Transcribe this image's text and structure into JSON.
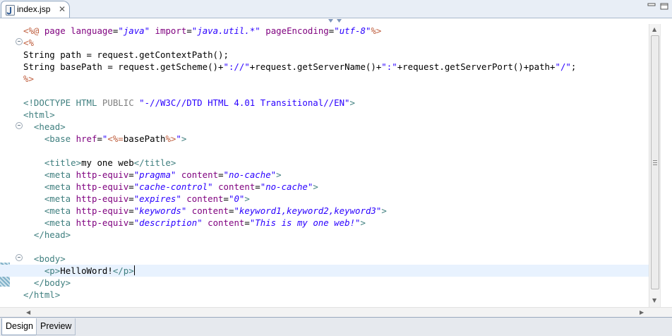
{
  "editor_tab": {
    "filename": "index.jsp",
    "icon": "jsp-file-icon",
    "close": "✕"
  },
  "code_lines": [
    [
      [
        "jsp",
        "<%@ "
      ],
      [
        "attr",
        "page "
      ],
      [
        "attr",
        "language"
      ],
      [
        "text",
        "="
      ],
      [
        "val",
        "\"java\""
      ],
      [
        "text",
        " "
      ],
      [
        "attr",
        "import"
      ],
      [
        "text",
        "="
      ],
      [
        "val",
        "\"java.util.*\""
      ],
      [
        "text",
        " "
      ],
      [
        "attr",
        "pageEncoding"
      ],
      [
        "text",
        "="
      ],
      [
        "val",
        "\"utf-8\""
      ],
      [
        "jsp",
        "%>"
      ]
    ],
    [
      [
        "jsp",
        "<%"
      ]
    ],
    [
      [
        "java",
        "String path = request.getContextPath();"
      ]
    ],
    [
      [
        "java",
        "String basePath = request.getScheme()+"
      ],
      [
        "str",
        "\"://\""
      ],
      [
        "java",
        "+request.getServerName()+"
      ],
      [
        "str",
        "\":\""
      ],
      [
        "java",
        "+request.getServerPort()+path+"
      ],
      [
        "str",
        "\"/\""
      ],
      [
        "java",
        ";"
      ]
    ],
    [
      [
        "jsp",
        "%>"
      ]
    ],
    [],
    [
      [
        "doctype",
        "<!DOCTYPE HTML "
      ],
      [
        "public",
        "PUBLIC "
      ],
      [
        "str",
        "\"-//W3C//DTD HTML 4.01 Transitional//EN\""
      ],
      [
        "doctype",
        ">"
      ]
    ],
    [
      [
        "tag",
        "<html>"
      ]
    ],
    [
      [
        "text",
        "  "
      ],
      [
        "tag",
        "<head>"
      ]
    ],
    [
      [
        "text",
        "    "
      ],
      [
        "tag",
        "<base "
      ],
      [
        "attr",
        "href"
      ],
      [
        "text",
        "="
      ],
      [
        "str",
        "\""
      ],
      [
        "jsp",
        "<%="
      ],
      [
        "java",
        "basePath"
      ],
      [
        "jsp",
        "%>"
      ],
      [
        "str",
        "\""
      ],
      [
        "tag",
        ">"
      ]
    ],
    [],
    [
      [
        "text",
        "    "
      ],
      [
        "tag",
        "<title>"
      ],
      [
        "text",
        "my one web"
      ],
      [
        "tag",
        "</title>"
      ]
    ],
    [
      [
        "text",
        "    "
      ],
      [
        "tag",
        "<meta "
      ],
      [
        "attr",
        "http-equiv"
      ],
      [
        "text",
        "="
      ],
      [
        "val",
        "\"pragma\""
      ],
      [
        "text",
        " "
      ],
      [
        "attr",
        "content"
      ],
      [
        "text",
        "="
      ],
      [
        "val",
        "\"no-cache\""
      ],
      [
        "tag",
        ">"
      ]
    ],
    [
      [
        "text",
        "    "
      ],
      [
        "tag",
        "<meta "
      ],
      [
        "attr",
        "http-equiv"
      ],
      [
        "text",
        "="
      ],
      [
        "val",
        "\"cache-control\""
      ],
      [
        "text",
        " "
      ],
      [
        "attr",
        "content"
      ],
      [
        "text",
        "="
      ],
      [
        "val",
        "\"no-cache\""
      ],
      [
        "tag",
        ">"
      ]
    ],
    [
      [
        "text",
        "    "
      ],
      [
        "tag",
        "<meta "
      ],
      [
        "attr",
        "http-equiv"
      ],
      [
        "text",
        "="
      ],
      [
        "val",
        "\"expires\""
      ],
      [
        "text",
        " "
      ],
      [
        "attr",
        "content"
      ],
      [
        "text",
        "="
      ],
      [
        "val",
        "\"0\""
      ],
      [
        "tag",
        ">"
      ]
    ],
    [
      [
        "text",
        "    "
      ],
      [
        "tag",
        "<meta "
      ],
      [
        "attr",
        "http-equiv"
      ],
      [
        "text",
        "="
      ],
      [
        "val",
        "\"keywords\""
      ],
      [
        "text",
        " "
      ],
      [
        "attr",
        "content"
      ],
      [
        "text",
        "="
      ],
      [
        "val",
        "\"keyword1,keyword2,keyword3\""
      ],
      [
        "tag",
        ">"
      ]
    ],
    [
      [
        "text",
        "    "
      ],
      [
        "tag",
        "<meta "
      ],
      [
        "attr",
        "http-equiv"
      ],
      [
        "text",
        "="
      ],
      [
        "val",
        "\"description\""
      ],
      [
        "text",
        " "
      ],
      [
        "attr",
        "content"
      ],
      [
        "text",
        "="
      ],
      [
        "val",
        "\"This is my one web!\""
      ],
      [
        "tag",
        ">"
      ]
    ],
    [
      [
        "text",
        "  "
      ],
      [
        "tag",
        "</head>"
      ]
    ],
    [],
    [
      [
        "text",
        "  "
      ],
      [
        "tag",
        "<body>"
      ]
    ],
    [
      [
        "text",
        "    "
      ],
      [
        "tag",
        "<p>"
      ],
      [
        "text",
        "HelloWord!"
      ],
      [
        "tag",
        "</p>"
      ],
      [
        "caret",
        ""
      ]
    ],
    [
      [
        "text",
        "  "
      ],
      [
        "tag",
        "</body>"
      ]
    ],
    [
      [
        "tag",
        "</html>"
      ]
    ]
  ],
  "current_line_index": 20,
  "bottom_tabs": [
    {
      "label": "Design",
      "active": true
    },
    {
      "label": "Preview",
      "active": false
    }
  ],
  "colors": {
    "jsp_delimiter": "#bf5f3f",
    "html_tag": "#3f7f7f",
    "attribute": "#7f007f",
    "attribute_value": "#2a00ff",
    "current_line_bg": "#e8f2fe"
  }
}
